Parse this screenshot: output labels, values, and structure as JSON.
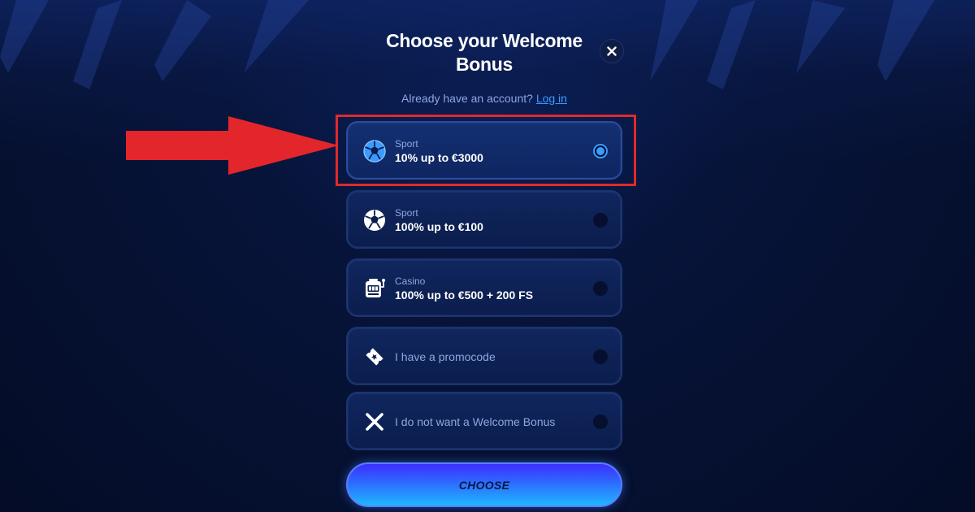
{
  "modal": {
    "title": "Choose your Welcome Bonus",
    "login_prompt": "Already have an account?",
    "login_link": "Log in"
  },
  "options": [
    {
      "category": "Sport",
      "label": "10% up to €3000",
      "icon": "soccer-ball-icon",
      "selected": true
    },
    {
      "category": "Sport",
      "label": "100% up to €100",
      "icon": "soccer-ball-icon",
      "selected": false
    },
    {
      "category": "Casino",
      "label": "100% up to €500 + 200 FS",
      "icon": "slot-machine-icon",
      "selected": false
    },
    {
      "category": "",
      "label": "I have a promocode",
      "icon": "ticket-icon",
      "selected": false
    },
    {
      "category": "",
      "label": "I do not want a Welcome Bonus",
      "icon": "x-icon",
      "selected": false
    }
  ],
  "choose_button": "CHOOSE",
  "colors": {
    "background": "#050f2c",
    "accent_blue": "#3a9bff",
    "highlight_red": "#e02a2a"
  }
}
